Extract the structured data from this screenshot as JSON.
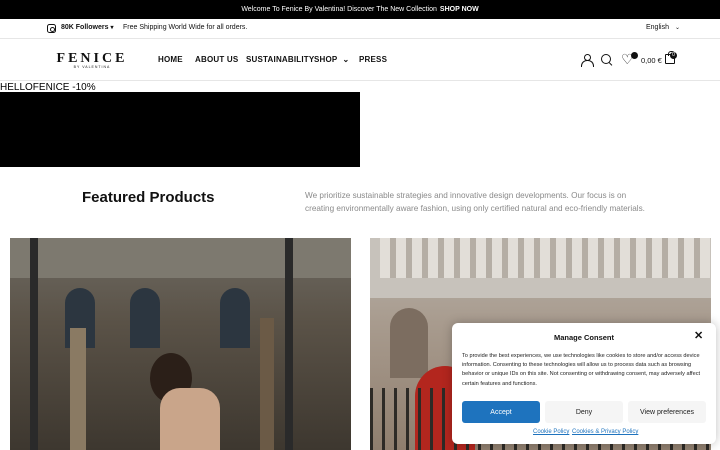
{
  "announcement": {
    "text": "Welcome To Fenice By Valentina! Discover The New Collection",
    "cta": "SHOP NOW"
  },
  "topbar": {
    "followers": "80K Followers",
    "shipping": "Free Shipping World Wide for all orders.",
    "language": "English"
  },
  "header": {
    "logo_main": "FENICE",
    "logo_sub": "BY VALENTINA",
    "menu": {
      "home": "HOME",
      "about": "ABOUT US",
      "sustainability": "SUSTAINABILITY",
      "shop": "SHOP",
      "press": "PRESS"
    },
    "wishlist_count": "",
    "cart_total": "0,00 €",
    "cart_count": "0"
  },
  "promo": {
    "code_text": "HELLOFENICE -10%"
  },
  "featured": {
    "title": "Featured Products",
    "intro": "We prioritize sustainable strategies and innovative design developments. Our focus is on creating environmentally aware fashion, using only certified natural and eco-friendly materials."
  },
  "consent": {
    "title": "Manage Consent",
    "body": "To provide the best experiences, we use technologies like cookies to store and/or access device information. Consenting to these technologies will allow us to process data such as browsing behavior or unique IDs on this site. Not consenting or withdrawing consent, may adversely affect certain features and functions.",
    "accept": "Accept",
    "deny": "Deny",
    "preferences": "View preferences",
    "cookie_policy": "Cookie Policy",
    "privacy_policy": "Cookies & Privacy Policy"
  },
  "icons": {
    "social": "instagram-icon",
    "account": "user-icon",
    "search": "search-icon",
    "wishlist": "heart-icon",
    "cart": "shopping-bag-icon",
    "close": "close-icon"
  },
  "colors": {
    "accent": "#1e73be",
    "announcement_bg": "#000000"
  }
}
